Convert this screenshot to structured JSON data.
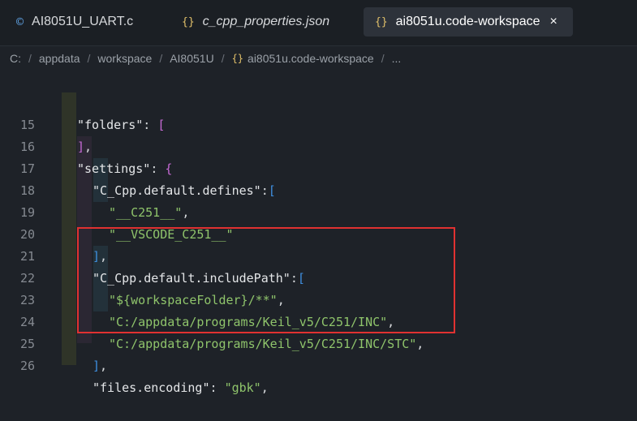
{
  "tabs": [
    {
      "icon": "©",
      "label": "AI8051U_UART.c"
    },
    {
      "icon": "{}",
      "label": "c_cpp_properties.json"
    },
    {
      "icon": "{}",
      "label": "ai8051u.code-workspace",
      "close": "×"
    }
  ],
  "breadcrumb": {
    "items": [
      "C:",
      "appdata",
      "workspace",
      "AI8051U"
    ],
    "file_icon": "{}",
    "file": "ai8051u.code-workspace",
    "ellipsis": "..."
  },
  "editor": {
    "lines": [
      {
        "num": "",
        "text": "\"folders\": ["
      },
      {
        "num": "15",
        "text": "],"
      },
      {
        "num": "16",
        "text": "\"settings\": {"
      },
      {
        "num": "17",
        "text": "\"C_Cpp.default.defines\":["
      },
      {
        "num": "18",
        "text": "\"__C251__\","
      },
      {
        "num": "19",
        "text": "\"__VSCODE_C251__\""
      },
      {
        "num": "20",
        "text": "],"
      },
      {
        "num": "21",
        "text": "\"C_Cpp.default.includePath\":["
      },
      {
        "num": "22",
        "text": "\"${workspaceFolder}/**\","
      },
      {
        "num": "23",
        "text": "\"C:/appdata/programs/Keil_v5/C251/INC\","
      },
      {
        "num": "24",
        "text": "\"C:/appdata/programs/Keil_v5/C251/INC/STC\","
      },
      {
        "num": "25",
        "text": "],"
      },
      {
        "num": "26",
        "text": "\"files.encoding\": \"gbk\","
      }
    ]
  },
  "colors": {
    "background": "#1e2228",
    "string": "#8fc46b",
    "key": "#e4e6e8",
    "bracket_magenta": "#c76ad6",
    "bracket_blue": "#3e8fe0",
    "highlight_box": "#e03131"
  }
}
